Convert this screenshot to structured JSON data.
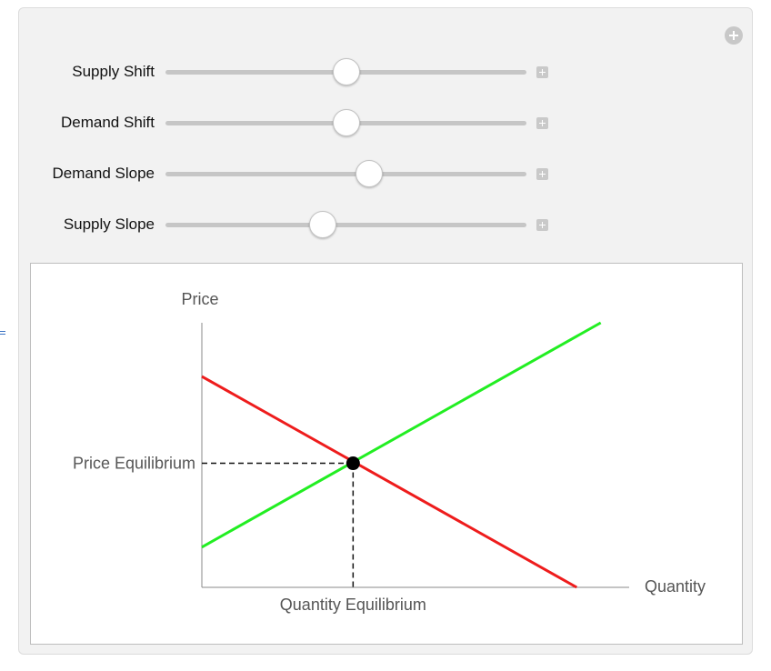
{
  "controls": [
    {
      "label": "Supply Shift",
      "value": 0.5
    },
    {
      "label": "Demand Shift",
      "value": 0.5
    },
    {
      "label": "Demand Slope",
      "value": 0.565
    },
    {
      "label": "Supply Slope",
      "value": 0.435
    }
  ],
  "icons": {
    "add": "plus-circle-icon",
    "expand": "plus-square-icon",
    "side": "equals-icon"
  },
  "chart_data": {
    "type": "line",
    "xlabel": "Quantity",
    "ylabel": "Price",
    "xlim": [
      0,
      10
    ],
    "ylim": [
      0,
      10
    ],
    "equilibrium_x_label": "Quantity Equilibrium",
    "equilibrium_y_label": "Price Equilibrium",
    "equilibrium": {
      "x": 3.97,
      "y": 4.69
    },
    "series": [
      {
        "role": "demand",
        "color": "#ee1c1c",
        "points": [
          [
            0,
            7.97
          ],
          [
            9.84,
            0
          ]
        ]
      },
      {
        "role": "supply",
        "color": "#22ee22",
        "points": [
          [
            0,
            1.52
          ],
          [
            10.47,
            10.0
          ]
        ]
      }
    ],
    "grid": false
  }
}
